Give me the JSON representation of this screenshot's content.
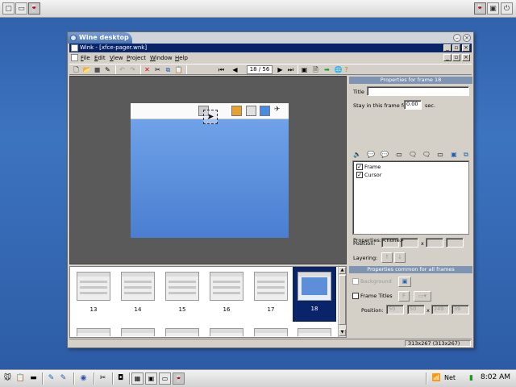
{
  "top_panel": {
    "icons": [
      "desktop-switch-icon",
      "minimize-all-icon",
      "wine-app-icon"
    ],
    "right_icons": [
      "wine-app-icon",
      "folder-icon",
      "power-icon"
    ]
  },
  "window": {
    "wm_title": "Wine desktop",
    "app_title": "Wink - [xfce-pager.wnk]",
    "menu": [
      "File",
      "Edit",
      "View",
      "Project",
      "Window",
      "Help"
    ],
    "frame_counter": "18 / 56"
  },
  "properties": {
    "header": "Properties for frame 18",
    "title_label": "Title",
    "title_value": "",
    "stay_label": "Stay in this frame for",
    "stay_value": "0.00",
    "stay_unit": "sec.",
    "objects": [
      {
        "label": "Frame",
        "checked": true
      },
      {
        "label": "Cursor",
        "checked": true
      }
    ],
    "position_label": "Position:",
    "position_sep": "x",
    "layering_label": "Layering:",
    "properties_label": "Properties:",
    "properties_value": "<none>"
  },
  "filmstrip": {
    "frames": [
      "13",
      "14",
      "15",
      "16",
      "17",
      "18"
    ],
    "selected": "18"
  },
  "common": {
    "header": "Properties common for all frames",
    "background_label": "Background",
    "frame_titles_label": "Frame Titles",
    "position_label": "Position:",
    "pos_values": [
      "50",
      "50",
      "249",
      "39"
    ],
    "pos_sep": "x"
  },
  "status": {
    "size": "313x267 (313x267)"
  },
  "taskbar": {
    "net_label": "Net",
    "clock": "8:02 AM"
  },
  "colors": {
    "desktop": "#2f5fa9",
    "title_active": "#0a246a",
    "props_header": "#7f94b3"
  }
}
